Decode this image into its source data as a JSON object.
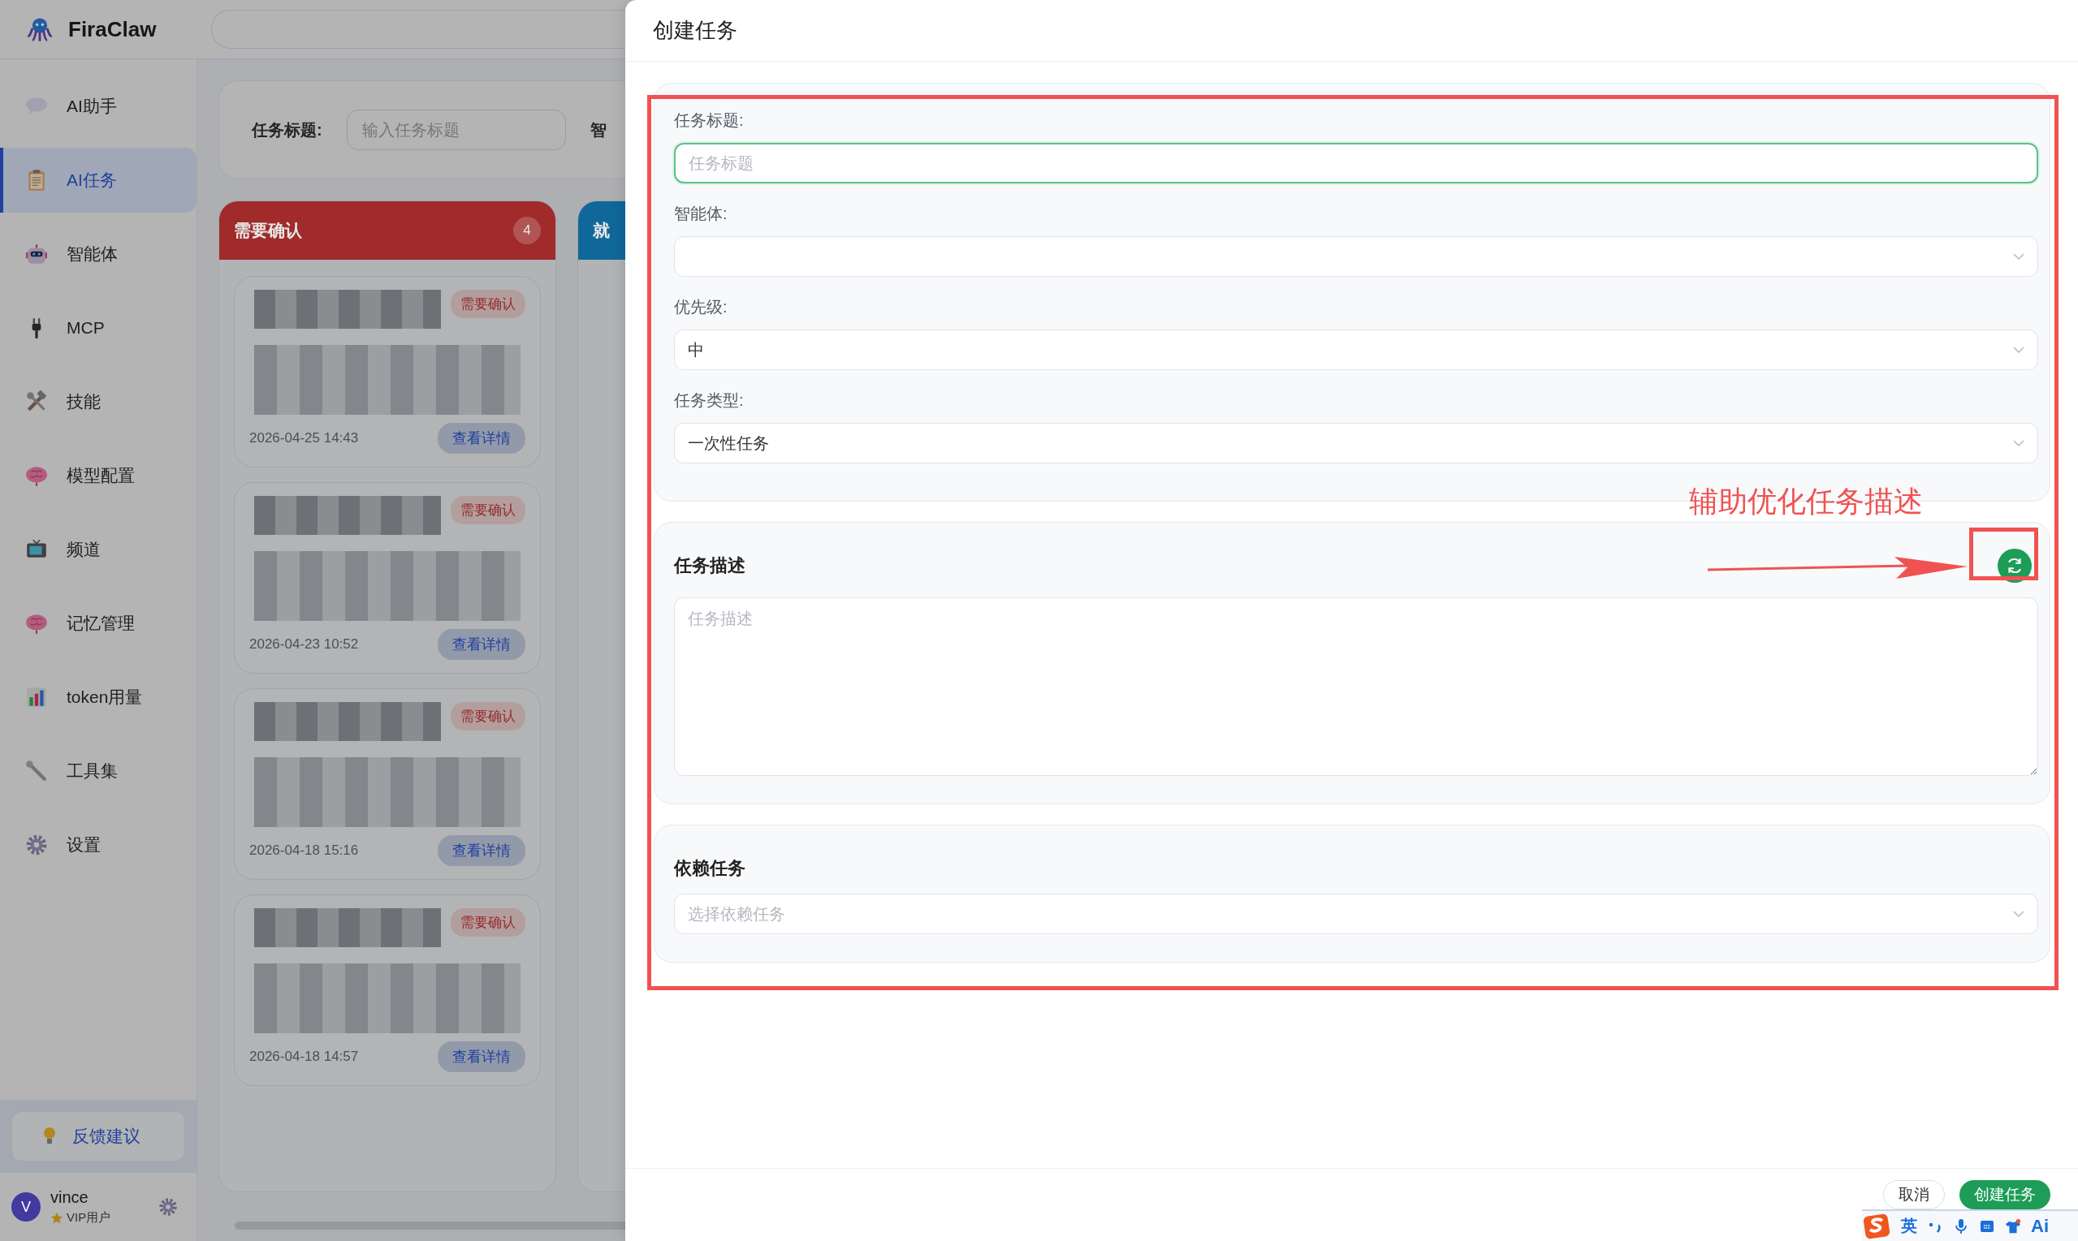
{
  "app": {
    "name": "FiraClaw"
  },
  "sidebar": {
    "items": [
      {
        "label": "AI助手",
        "selected": false
      },
      {
        "label": "AI任务",
        "selected": true
      },
      {
        "label": "智能体",
        "selected": false
      },
      {
        "label": "MCP",
        "selected": false
      },
      {
        "label": "技能",
        "selected": false
      },
      {
        "label": "模型配置",
        "selected": false
      },
      {
        "label": "频道",
        "selected": false
      },
      {
        "label": "记忆管理",
        "selected": false
      },
      {
        "label": "token用量",
        "selected": false
      },
      {
        "label": "工具集",
        "selected": false
      },
      {
        "label": "设置",
        "selected": false
      }
    ],
    "feedback": "反馈建议",
    "user": {
      "avatar": "V",
      "name": "vince",
      "role": "VIP用户"
    }
  },
  "filter": {
    "fields": [
      {
        "label": "任务标题:",
        "placeholder": "输入任务标题"
      },
      {
        "label": "智"
      }
    ]
  },
  "columns": [
    {
      "title": "需要确认",
      "count": "4",
      "color": "#a12a2a",
      "cards": [
        {
          "badge": "需要确认",
          "time": "2026-04-25 14:43",
          "action": "查看详情"
        },
        {
          "badge": "需要确认",
          "time": "2026-04-23 10:52",
          "action": "查看详情"
        },
        {
          "badge": "需要确认",
          "time": "2026-04-18 15:16",
          "action": "查看详情"
        },
        {
          "badge": "需要确认",
          "time": "2026-04-18 14:57",
          "action": "查看详情"
        }
      ]
    },
    {
      "title": "就",
      "color": "#10689a"
    }
  ],
  "dialog": {
    "title": "创建任务",
    "fields": [
      {
        "label": "任务标题:",
        "kind": "input",
        "placeholder": "任务标题",
        "focused": true
      },
      {
        "label": "智能体:",
        "kind": "select"
      },
      {
        "label": "优先级:",
        "kind": "select",
        "value": "中"
      },
      {
        "label": "任务类型:",
        "kind": "select",
        "value": "一次性任务"
      }
    ],
    "description": {
      "heading": "任务描述",
      "placeholder": "任务描述"
    },
    "dependencies": {
      "heading": "依赖任务",
      "placeholder": "选择依赖任务"
    },
    "buttons": [
      {
        "label": "取消",
        "kind": "secondary"
      },
      {
        "label": "创建任务",
        "kind": "primary"
      }
    ]
  },
  "annotation": {
    "text": "辅助优化任务描述"
  },
  "ime": {
    "mode": "英",
    "ai": "Ai"
  }
}
